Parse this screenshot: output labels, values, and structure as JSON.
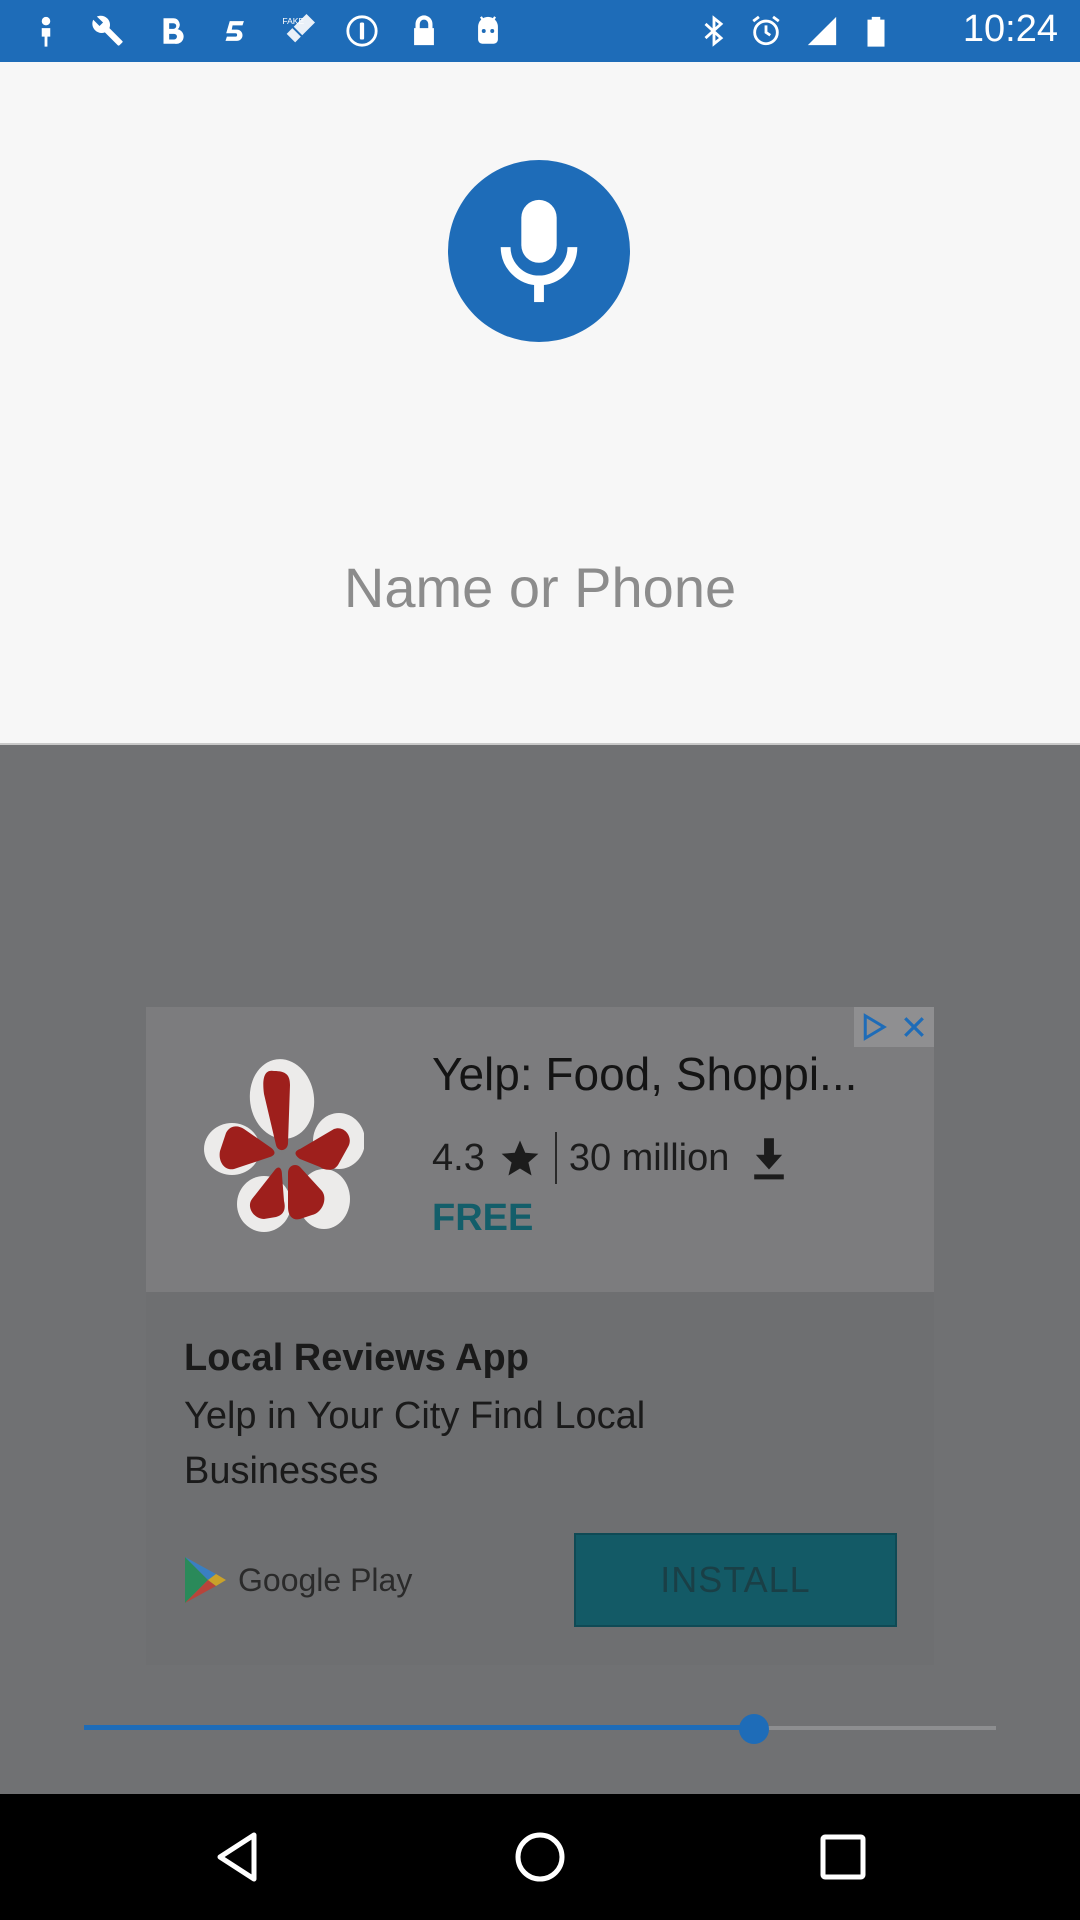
{
  "status_bar": {
    "time": "10:24",
    "left_icons": [
      "person-pin-icon",
      "wrench-icon",
      "bold-b-icon",
      "five-icon",
      "satellite-fake-icon",
      "info-icon",
      "lock-icon",
      "android-icon"
    ],
    "right_icons": [
      "bluetooth-icon",
      "alarm-icon",
      "signal-icon",
      "battery-icon"
    ]
  },
  "search": {
    "placeholder": "Name or Phone",
    "mic_icon": "mic-icon"
  },
  "ad": {
    "app_title": "Yelp: Food, Shoppi...",
    "rating": "4.3",
    "downloads": "30 million",
    "price": "FREE",
    "headline": "Local Reviews App",
    "body": "Yelp in Your City Find Local Businesses",
    "store": "Google Play",
    "install_label": "INSTALL"
  },
  "slider": {
    "value_fraction": 0.735
  },
  "colors": {
    "accent": "#1e6cb8",
    "status_bar": "#1e6cb8",
    "panel_bg": "#f7f7f7",
    "overlay_bg": "#707173",
    "install_bg": "#135a66"
  }
}
